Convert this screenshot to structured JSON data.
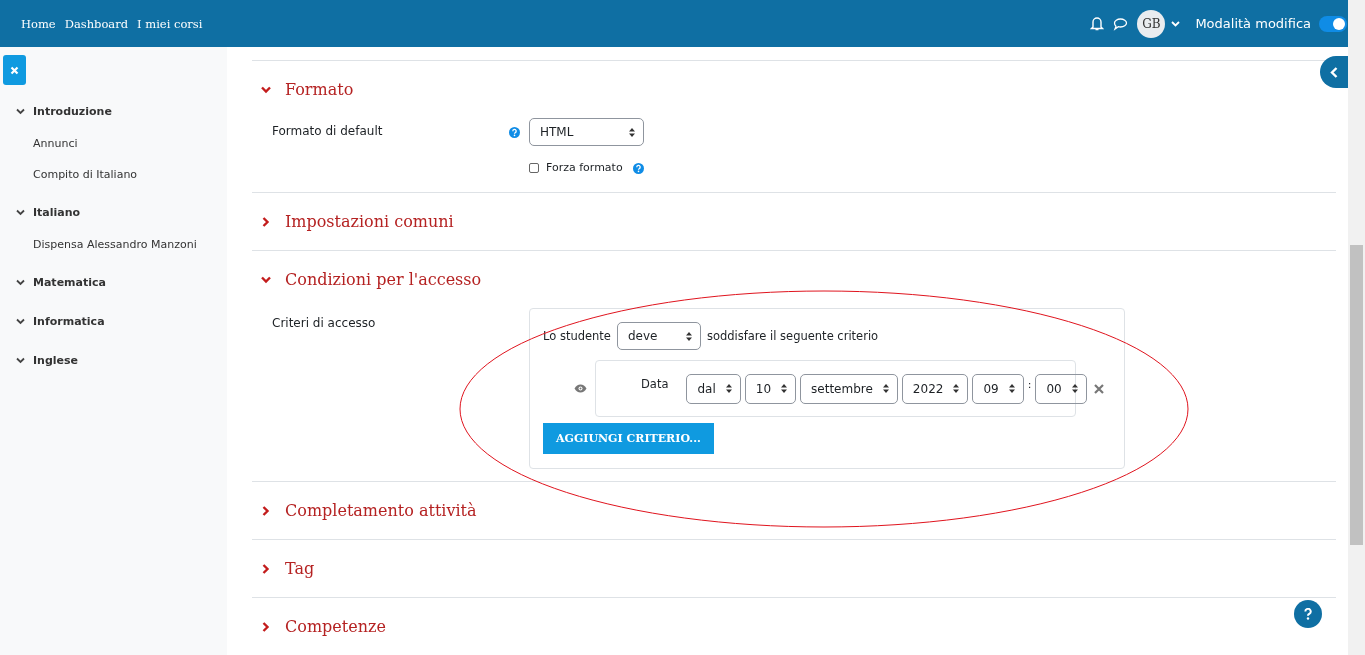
{
  "navbar": {
    "links": [
      "Home",
      "Dashboard",
      "I miei corsi"
    ],
    "user_initials": "GB",
    "edit_mode": {
      "label": "Modalità modifica",
      "on": true
    }
  },
  "sidebar": {
    "sections": [
      {
        "title": "Introduzione",
        "expanded": true,
        "items": [
          "Annunci",
          "Compito di Italiano"
        ]
      },
      {
        "title": "Italiano",
        "expanded": true,
        "items": [
          "Dispensa Alessandro Manzoni"
        ]
      },
      {
        "title": "Matematica",
        "expanded": true
      },
      {
        "title": "Informatica",
        "expanded": true
      },
      {
        "title": "Inglese",
        "expanded": true
      }
    ]
  },
  "sections": [
    {
      "title": "Formato",
      "expanded": true,
      "kind": "format",
      "field": {
        "label": "Formato di default",
        "value": "HTML"
      },
      "checkbox": {
        "label": "Forza formato",
        "checked": false
      }
    },
    {
      "title": "Impostazioni comuni",
      "expanded": false
    },
    {
      "title": "Condizioni per l'accesso",
      "expanded": true,
      "kind": "access",
      "label": "Criteri di accesso",
      "prefix": "Lo studente",
      "mode": "deve",
      "suffix": "soddisfare il seguente criterio",
      "criterion": {
        "type": "Data",
        "fields": [
          {
            "kind": "select",
            "value": "dal"
          },
          {
            "kind": "select",
            "value": "10"
          },
          {
            "kind": "select",
            "value": "settembre"
          },
          {
            "kind": "select",
            "value": "2022"
          },
          {
            "kind": "select",
            "value": "09"
          },
          {
            "kind": "separator",
            "text": ":"
          },
          {
            "kind": "select",
            "value": "00"
          }
        ]
      },
      "add_button": "AGGIUNGI CRITERIO..."
    },
    {
      "title": "Completamento attività",
      "expanded": false
    },
    {
      "title": "Tag",
      "expanded": false
    },
    {
      "title": "Competenze",
      "expanded": false
    }
  ]
}
